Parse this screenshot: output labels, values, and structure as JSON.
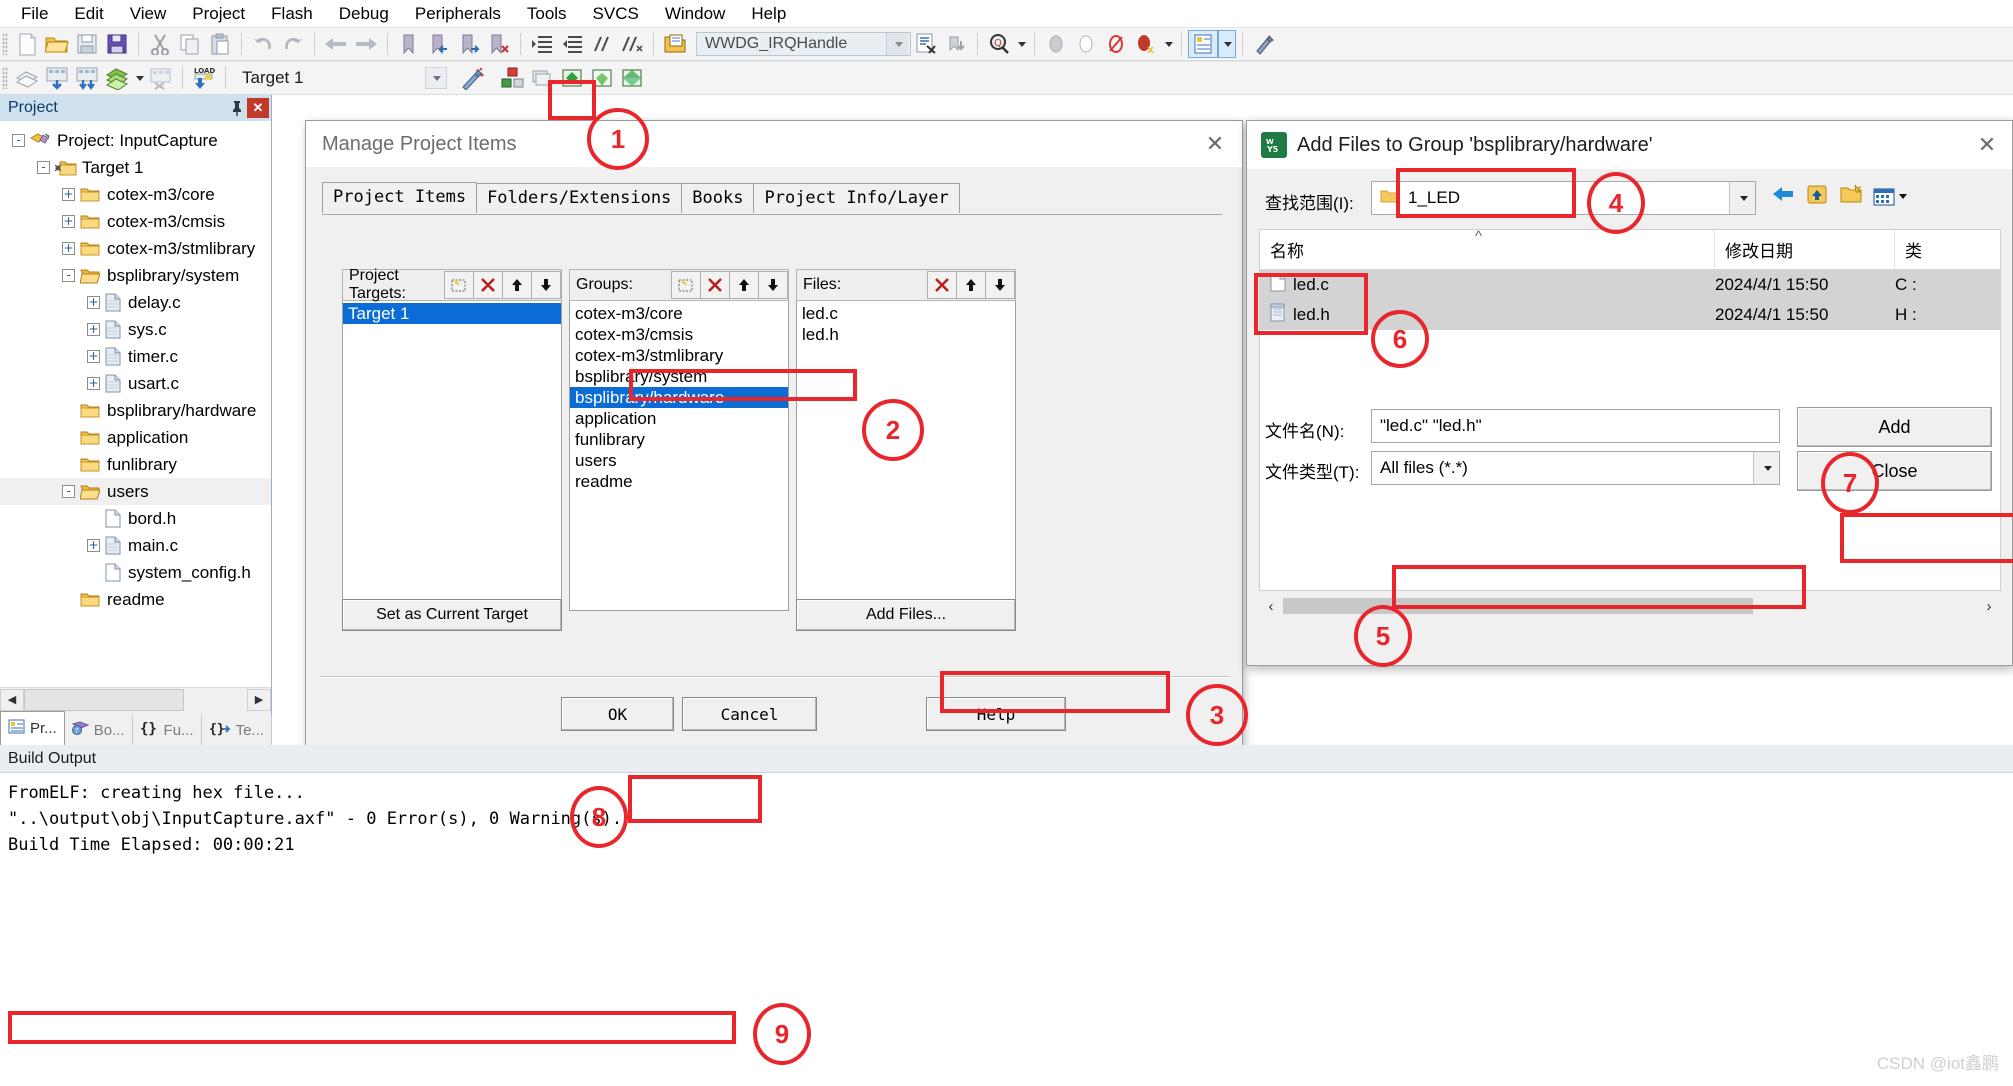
{
  "menubar": {
    "items": [
      "File",
      "Edit",
      "View",
      "Project",
      "Flash",
      "Debug",
      "Peripherals",
      "Tools",
      "SVCS",
      "Window",
      "Help"
    ]
  },
  "toolbar2": {
    "target_value": "Target 1",
    "symbol_value": "WWDG_IRQHandle"
  },
  "project_pane": {
    "title": "Project",
    "pin_icon": "pin-icon",
    "close_icon": "close-icon",
    "tree": [
      {
        "label": "Project: InputCapture",
        "depth": 0,
        "expander": "-",
        "icon": "project-icon"
      },
      {
        "label": "Target 1",
        "depth": 1,
        "expander": "-",
        "icon": "target-folder-icon"
      },
      {
        "label": "cotex-m3/core",
        "depth": 2,
        "expander": "+",
        "icon": "folder-icon"
      },
      {
        "label": "cotex-m3/cmsis",
        "depth": 2,
        "expander": "+",
        "icon": "folder-icon"
      },
      {
        "label": "cotex-m3/stmlibrary",
        "depth": 2,
        "expander": "+",
        "icon": "folder-icon"
      },
      {
        "label": "bsplibrary/system",
        "depth": 2,
        "expander": "-",
        "icon": "folder-open-icon"
      },
      {
        "label": "delay.c",
        "depth": 3,
        "expander": "+",
        "icon": "c-file-icon"
      },
      {
        "label": "sys.c",
        "depth": 3,
        "expander": "+",
        "icon": "c-file-icon"
      },
      {
        "label": "timer.c",
        "depth": 3,
        "expander": "+",
        "icon": "c-file-icon"
      },
      {
        "label": "usart.c",
        "depth": 3,
        "expander": "+",
        "icon": "c-file-icon"
      },
      {
        "label": "bsplibrary/hardware",
        "depth": 2,
        "expander": "",
        "icon": "folder-icon"
      },
      {
        "label": "application",
        "depth": 2,
        "expander": "",
        "icon": "folder-icon"
      },
      {
        "label": "funlibrary",
        "depth": 2,
        "expander": "",
        "icon": "folder-icon"
      },
      {
        "label": "users",
        "depth": 2,
        "expander": "-",
        "icon": "folder-open-icon",
        "selected": true
      },
      {
        "label": "bord.h",
        "depth": 3,
        "expander": "",
        "icon": "h-file-icon"
      },
      {
        "label": "main.c",
        "depth": 3,
        "expander": "+",
        "icon": "c-file-icon"
      },
      {
        "label": "system_config.h",
        "depth": 3,
        "expander": "",
        "icon": "h-file-icon"
      },
      {
        "label": "readme",
        "depth": 2,
        "expander": "",
        "icon": "folder-icon"
      }
    ],
    "tabs": [
      {
        "label": "Pr...",
        "icon": "project-tab-icon",
        "active": true
      },
      {
        "label": "Bo...",
        "icon": "books-tab-icon",
        "active": false
      },
      {
        "label": "Fu...",
        "icon": "functions-tab-icon",
        "active": false
      },
      {
        "label": "Te...",
        "icon": "templates-tab-icon",
        "active": false
      }
    ]
  },
  "manage_dialog": {
    "title": "Manage Project Items",
    "close_icon": "close-icon",
    "tabs": [
      {
        "label": "Project Items",
        "active": true
      },
      {
        "label": "Folders/Extensions",
        "active": false
      },
      {
        "label": "Books",
        "active": false
      },
      {
        "label": "Project Info/Layer",
        "active": false
      }
    ],
    "project_targets": {
      "header": "Project Targets:",
      "buttons": [
        "new-icon",
        "delete-icon",
        "move-up-icon",
        "move-down-icon"
      ],
      "items": [
        {
          "label": "Target 1",
          "selected": true
        }
      ]
    },
    "groups": {
      "header": "Groups:",
      "buttons": [
        "new-icon",
        "delete-icon",
        "move-up-icon",
        "move-down-icon"
      ],
      "items": [
        {
          "label": "cotex-m3/core",
          "selected": false
        },
        {
          "label": "cotex-m3/cmsis",
          "selected": false
        },
        {
          "label": "cotex-m3/stmlibrary",
          "selected": false
        },
        {
          "label": "bsplibrary/system",
          "selected": false
        },
        {
          "label": "bsplibrary/hardware",
          "selected": true
        },
        {
          "label": "application",
          "selected": false
        },
        {
          "label": "funlibrary",
          "selected": false
        },
        {
          "label": "users",
          "selected": false
        },
        {
          "label": "readme",
          "selected": false
        }
      ]
    },
    "files": {
      "header": "Files:",
      "buttons": [
        "delete-icon",
        "move-up-icon",
        "move-down-icon"
      ],
      "items": [
        {
          "label": "led.c",
          "selected": false
        },
        {
          "label": "led.h",
          "selected": false
        }
      ]
    },
    "set_target_label": "Set as Current Target",
    "add_files_label": "Add Files...",
    "ok_label": "OK",
    "cancel_label": "Cancel",
    "help_label": "Help"
  },
  "add_files_dialog": {
    "title": "Add Files to Group 'bsplibrary/hardware'",
    "app_icon": "keil-uvision-icon",
    "close_icon": "close-icon",
    "lookin_label": "查找范围(I):",
    "lookin_value": "1_LED",
    "nav_icons": [
      "back-arrow-icon",
      "up-folder-icon",
      "new-folder-icon",
      "view-mode-icon"
    ],
    "columns": [
      "名称",
      "修改日期",
      "类"
    ],
    "sort_indicator": "^",
    "rows": [
      {
        "name": "led.c",
        "icon": "c-file-icon",
        "modified": "2024/4/1 15:50",
        "type": "C :",
        "selected": true
      },
      {
        "name": "led.h",
        "icon": "h-file-icon",
        "modified": "2024/4/1 15:50",
        "type": "H :",
        "selected": true
      }
    ],
    "scroll_left_icon": "chevron-left-icon",
    "scroll_right_icon": "chevron-right-icon",
    "filename_label": "文件名(N):",
    "filename_value": "\"led.c\" \"led.h\"",
    "filetype_label": "文件类型(T):",
    "filetype_value": "All files (*.*)",
    "add_label": "Add",
    "close_label": "Close"
  },
  "build_output": {
    "title": "Build Output",
    "lines": [
      "FromELF: creating hex file...",
      "\"..\\output\\obj\\InputCapture.axf\" - 0 Error(s), 0 Warning(s).",
      "Build Time Elapsed:  00:00:21"
    ]
  },
  "annotations": {
    "markers": [
      "1",
      "2",
      "3",
      "4",
      "5",
      "6",
      "7",
      "8",
      "9"
    ],
    "color": "#e8262c"
  },
  "watermark": "CSDN @iot鑫鹏"
}
